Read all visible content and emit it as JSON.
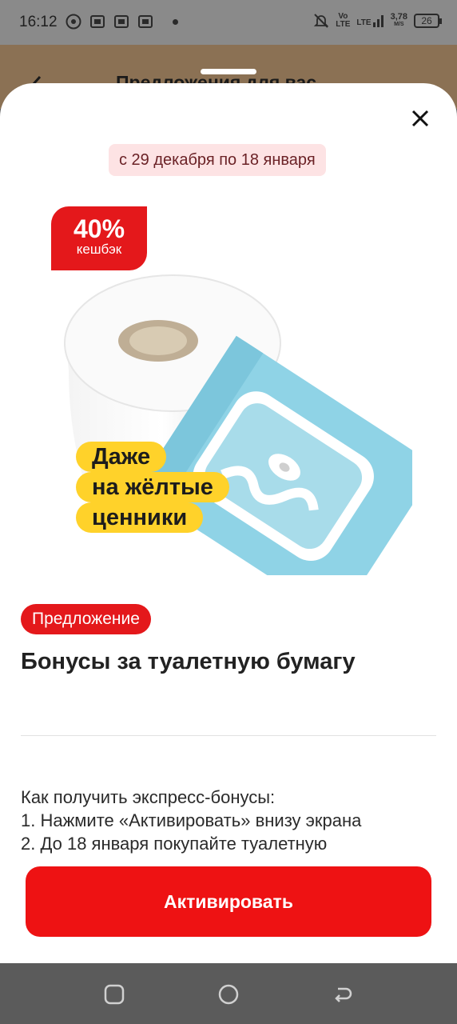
{
  "status_bar": {
    "time": "16:12",
    "network_vo": "Vo",
    "network_lte1": "LTE",
    "network_lte2": "LTE",
    "speed": "3,78",
    "speed_unit": "M/S",
    "battery": "26"
  },
  "background_page": {
    "back_icon": "chevron-left-icon",
    "title": "Предложения для вас"
  },
  "sheet": {
    "close_icon": "close-icon",
    "date_range": "с 29 декабря по 18 января",
    "image": {
      "cashback_percent": "40%",
      "cashback_label": "кешбэк",
      "note_lines": [
        "Даже",
        "на жёлтые",
        "ценники"
      ]
    },
    "tag": "Предложение",
    "title": "Бонусы за туалетную бумагу",
    "howto_lines": [
      "Как получить экспресс-бонусы:",
      "1. Нажмите «Активировать» внизу экрана",
      "2. До 18 января покупайте туалетную"
    ],
    "activate_button": "Активировать"
  },
  "colors": {
    "accent_red": "#ee1213",
    "date_pill_bg": "#fde3e4",
    "note_yellow": "#ffd22a",
    "wipes_blue": "#8fd3e6"
  }
}
